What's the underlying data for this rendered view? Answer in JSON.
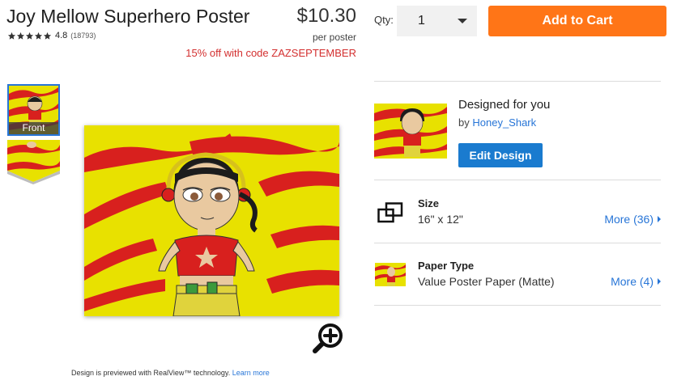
{
  "product": {
    "title": "Joy Mellow Superhero Poster",
    "rating": "4.8",
    "review_count": "(18793)",
    "stars": 5,
    "price": "$10.30",
    "price_unit": "per poster",
    "promo": "15% off with code ZAZSEPTEMBER"
  },
  "purchase": {
    "qty_label": "Qty:",
    "qty_value": "1",
    "add_to_cart_label": "Add to Cart"
  },
  "gallery": {
    "thumbs": [
      {
        "label": "Front",
        "selected": true
      },
      {
        "label": "",
        "selected": false
      }
    ],
    "realview_text": "Design is previewed with RealView™ technology.",
    "learn_more_label": "Learn more"
  },
  "designer": {
    "title": "Designed for you",
    "by_prefix": "by",
    "name": "Honey_Shark",
    "edit_label": "Edit Design"
  },
  "options": [
    {
      "title": "Size",
      "value": "16\" x 12\"",
      "more_label": "More (36)",
      "icon": "size-frame-icon"
    },
    {
      "title": "Paper Type",
      "value": "Value Poster Paper (Matte)",
      "more_label": "More (4)",
      "icon": "paper-thumbnail"
    }
  ],
  "colors": {
    "accent_orange": "#ff7517",
    "link_blue": "#2775d7",
    "edit_blue": "#1a7bcf",
    "promo_red": "#d32f2f",
    "poster_yellow": "#e8e100",
    "poster_red": "#d8201e"
  }
}
